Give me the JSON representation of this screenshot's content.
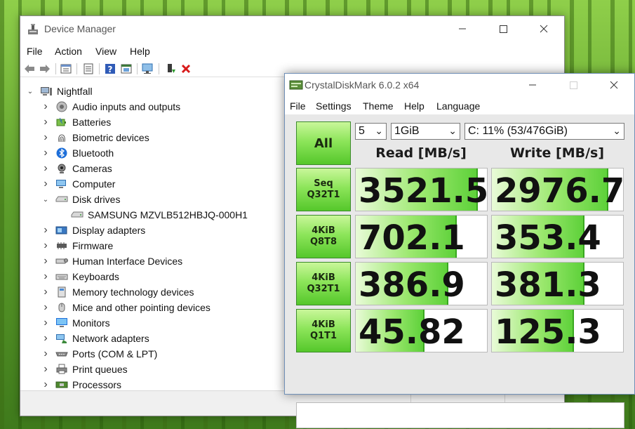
{
  "device_manager": {
    "title": "Device Manager",
    "menu": [
      "File",
      "Action",
      "View",
      "Help"
    ],
    "toolbar_icons": [
      "back-arrow-icon",
      "forward-arrow-icon",
      "properties-icon",
      "update-driver-icon",
      "help-icon",
      "show-hidden-icon",
      "scan-hardware-icon",
      "enable-device-icon",
      "uninstall-device-icon"
    ],
    "tree": {
      "root": "Nightfall",
      "items": [
        {
          "label": "Audio inputs and outputs",
          "icon": "speaker-icon",
          "expanded": false
        },
        {
          "label": "Batteries",
          "icon": "battery-icon",
          "expanded": false
        },
        {
          "label": "Biometric devices",
          "icon": "fingerprint-icon",
          "expanded": false
        },
        {
          "label": "Bluetooth",
          "icon": "bluetooth-icon",
          "expanded": false
        },
        {
          "label": "Cameras",
          "icon": "camera-icon",
          "expanded": false
        },
        {
          "label": "Computer",
          "icon": "computer-icon",
          "expanded": false
        },
        {
          "label": "Disk drives",
          "icon": "disk-drive-icon",
          "expanded": true,
          "children": [
            {
              "label": "SAMSUNG MZVLB512HBJQ-000H1",
              "icon": "disk-drive-icon"
            }
          ]
        },
        {
          "label": "Display adapters",
          "icon": "display-adapter-icon",
          "expanded": false
        },
        {
          "label": "Firmware",
          "icon": "chip-icon",
          "expanded": false
        },
        {
          "label": "Human Interface Devices",
          "icon": "hid-icon",
          "expanded": false
        },
        {
          "label": "Keyboards",
          "icon": "keyboard-icon",
          "expanded": false
        },
        {
          "label": "Memory technology devices",
          "icon": "memory-icon",
          "expanded": false
        },
        {
          "label": "Mice and other pointing devices",
          "icon": "mouse-icon",
          "expanded": false
        },
        {
          "label": "Monitors",
          "icon": "monitor-icon",
          "expanded": false
        },
        {
          "label": "Network adapters",
          "icon": "network-icon",
          "expanded": false
        },
        {
          "label": "Ports (COM & LPT)",
          "icon": "port-icon",
          "expanded": false
        },
        {
          "label": "Print queues",
          "icon": "printer-icon",
          "expanded": false
        },
        {
          "label": "Processors",
          "icon": "processor-icon",
          "expanded": false
        }
      ]
    }
  },
  "crystal_disk_mark": {
    "title": "CrystalDiskMark 6.0.2 x64",
    "menu": [
      "File",
      "Settings",
      "Theme",
      "Help",
      "Language"
    ],
    "all_button": "All",
    "count_select": "5",
    "size_select": "1GiB",
    "drive_select": "C: 11% (53/476GiB)",
    "read_header": "Read [MB/s]",
    "write_header": "Write [MB/s]",
    "tests": [
      {
        "line1": "Seq",
        "line2": "Q32T1",
        "read": "3521.5",
        "write": "2976.7",
        "read_level": 0.92,
        "write_level": 0.88
      },
      {
        "line1": "4KiB",
        "line2": "Q8T8",
        "read": "702.1",
        "write": "353.4",
        "read_level": 0.76,
        "write_level": 0.7
      },
      {
        "line1": "4KiB",
        "line2": "Q32T1",
        "read": "386.9",
        "write": "381.3",
        "read_level": 0.7,
        "write_level": 0.7
      },
      {
        "line1": "4KiB",
        "line2": "Q1T1",
        "read": "45.82",
        "write": "125.3",
        "read_level": 0.52,
        "write_level": 0.62
      }
    ],
    "accent": "#55c72b"
  }
}
